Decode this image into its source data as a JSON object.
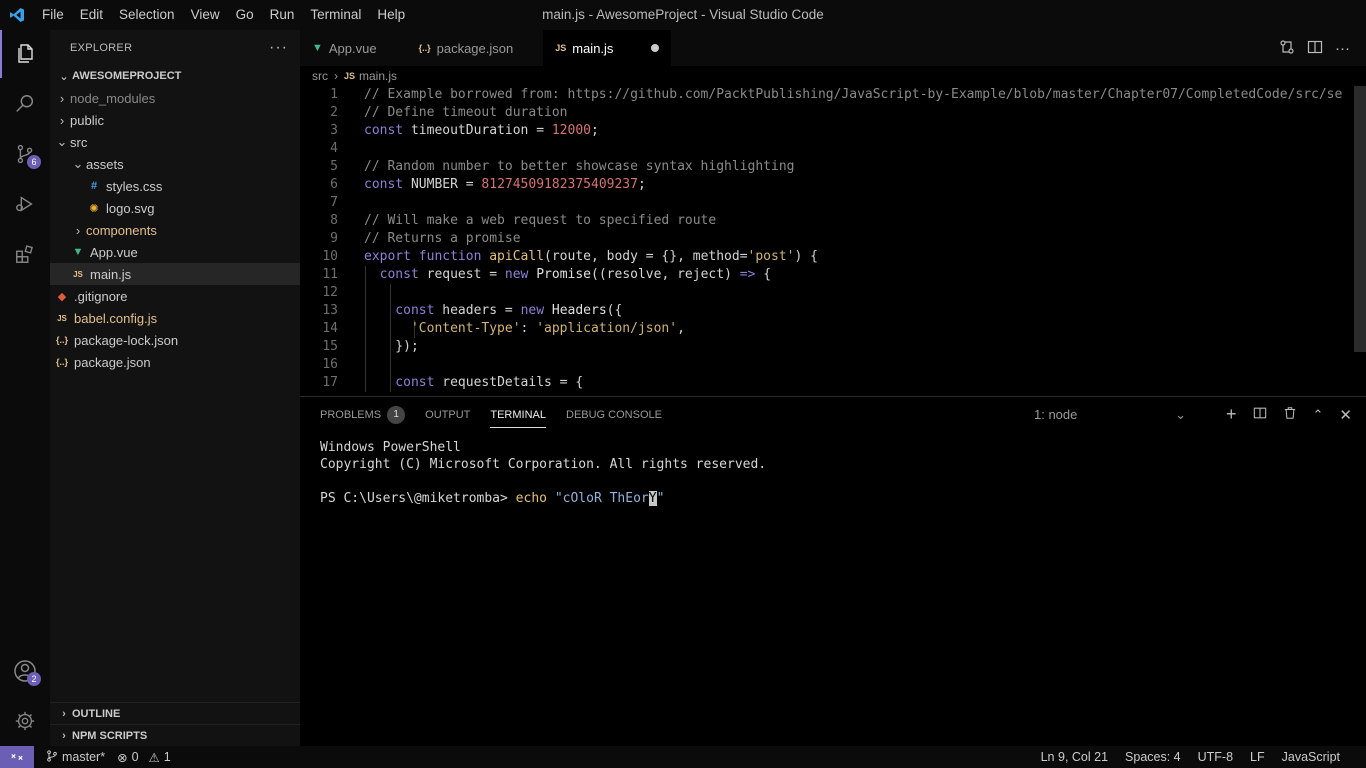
{
  "window": {
    "title": "main.js - AwesomeProject - Visual Studio Code"
  },
  "menu": [
    "File",
    "Edit",
    "Selection",
    "View",
    "Go",
    "Run",
    "Terminal",
    "Help"
  ],
  "activity": {
    "scm_badge": "6",
    "accounts_badge": "2"
  },
  "sidebar": {
    "header": "EXPLORER",
    "project": "AWESOMEPROJECT",
    "tree": [
      {
        "label": "node_modules",
        "indent": 1,
        "type": "folder",
        "open": false,
        "dim": true
      },
      {
        "label": "public",
        "indent": 1,
        "type": "folder",
        "open": false
      },
      {
        "label": "src",
        "indent": 1,
        "type": "folder",
        "open": true
      },
      {
        "label": "assets",
        "indent": 2,
        "type": "folder",
        "open": true
      },
      {
        "label": "styles.css",
        "indent": 3,
        "type": "css"
      },
      {
        "label": "logo.svg",
        "indent": 3,
        "type": "svg"
      },
      {
        "label": "components",
        "indent": 2,
        "type": "folder",
        "open": false,
        "color": "#e2c08d"
      },
      {
        "label": "App.vue",
        "indent": 2,
        "type": "vue"
      },
      {
        "label": "main.js",
        "indent": 2,
        "type": "js",
        "selected": true
      },
      {
        "label": ".gitignore",
        "indent": 1,
        "type": "git"
      },
      {
        "label": "babel.config.js",
        "indent": 1,
        "type": "js",
        "color": "#e2c08d"
      },
      {
        "label": "package-lock.json",
        "indent": 1,
        "type": "json"
      },
      {
        "label": "package.json",
        "indent": 1,
        "type": "json"
      }
    ],
    "outline": "OUTLINE",
    "npm": "NPM SCRIPTS"
  },
  "tabs": [
    {
      "label": "App.vue",
      "type": "vue"
    },
    {
      "label": "package.json",
      "type": "json"
    },
    {
      "label": "main.js",
      "type": "js",
      "active": true,
      "dirty": true
    }
  ],
  "breadcrumb": [
    "src",
    "main.js"
  ],
  "code": [
    {
      "n": "1",
      "depth": 0,
      "t": [
        [
          "c-com",
          "// Example borrowed from: https://github.com/PacktPublishing/JavaScript-by-Example/blob/master/Chapter07/CompletedCode/src/se"
        ]
      ]
    },
    {
      "n": "2",
      "depth": 0,
      "t": [
        [
          "c-com",
          "// Define timeout duration"
        ]
      ]
    },
    {
      "n": "3",
      "depth": 0,
      "t": [
        [
          "c-kw",
          "const "
        ],
        [
          "c-id",
          "timeoutDuration = "
        ],
        [
          "c-num",
          "12000"
        ],
        [
          "c-id",
          ";"
        ]
      ]
    },
    {
      "n": "4",
      "depth": 0,
      "t": []
    },
    {
      "n": "5",
      "depth": 0,
      "t": [
        [
          "c-com",
          "// Random number to better showcase syntax highlighting"
        ]
      ]
    },
    {
      "n": "6",
      "depth": 0,
      "t": [
        [
          "c-kw",
          "const "
        ],
        [
          "c-id",
          "NUMBER = "
        ],
        [
          "c-num",
          "812745091823754092​37"
        ],
        [
          "c-id",
          ";"
        ]
      ]
    },
    {
      "n": "7",
      "depth": 0,
      "t": []
    },
    {
      "n": "8",
      "depth": 0,
      "t": [
        [
          "c-com",
          "// Will make a web request to specified route"
        ]
      ]
    },
    {
      "n": "9",
      "depth": 0,
      "t": [
        [
          "c-com",
          "// Returns a promise"
        ]
      ]
    },
    {
      "n": "10",
      "depth": 0,
      "t": [
        [
          "c-kw",
          "export function "
        ],
        [
          "c-fn",
          "apiCall"
        ],
        [
          "c-id",
          "(route, body = {}, method="
        ],
        [
          "c-str",
          "'post'"
        ],
        [
          "c-id",
          ") {"
        ]
      ]
    },
    {
      "n": "11",
      "depth": 1,
      "t": [
        [
          "c-kw",
          "  const "
        ],
        [
          "c-id",
          "request = "
        ],
        [
          "c-kw",
          "new "
        ],
        [
          "c-cls",
          "Promise"
        ],
        [
          "c-id",
          "((resolve, reject) "
        ],
        [
          "c-kw",
          "=> "
        ],
        [
          "c-id",
          "{"
        ]
      ]
    },
    {
      "n": "12",
      "depth": 2,
      "t": []
    },
    {
      "n": "13",
      "depth": 2,
      "t": [
        [
          "c-kw",
          "    const "
        ],
        [
          "c-id",
          "headers = "
        ],
        [
          "c-kw",
          "new "
        ],
        [
          "c-cls",
          "Headers"
        ],
        [
          "c-id",
          "({"
        ]
      ]
    },
    {
      "n": "14",
      "depth": 3,
      "t": [
        [
          "c-str",
          "      'Content-Type'"
        ],
        [
          "c-id",
          ": "
        ],
        [
          "c-str",
          "'application/json'"
        ],
        [
          "c-id",
          ","
        ]
      ]
    },
    {
      "n": "15",
      "depth": 2,
      "t": [
        [
          "c-id",
          "    });"
        ]
      ]
    },
    {
      "n": "16",
      "depth": 2,
      "t": []
    },
    {
      "n": "17",
      "depth": 2,
      "t": [
        [
          "c-kw",
          "    const "
        ],
        [
          "c-id",
          "requestDetails = {"
        ]
      ]
    }
  ],
  "panel": {
    "tabs": [
      {
        "label": "PROBLEMS",
        "badge": "1"
      },
      {
        "label": "OUTPUT"
      },
      {
        "label": "TERMINAL",
        "active": true
      },
      {
        "label": "DEBUG CONSOLE"
      }
    ],
    "terminal_select": "1: node",
    "terminal_lines": [
      "Windows PowerShell",
      "Copyright (C) Microsoft Corporation. All rights reserved.",
      ""
    ],
    "prompt": "PS C:\\Users\\@miketromba> ",
    "command": "echo ",
    "arg": "\"cOloR ThEor",
    "cursor_char": "Y",
    "arg_end": "\""
  },
  "status": {
    "branch": "master*",
    "errors": "0",
    "warnings": "1",
    "position": "Ln 9, Col 21",
    "spaces": "Spaces: 4",
    "encoding": "UTF-8",
    "eol": "LF",
    "language": "JavaScript"
  },
  "colors": {
    "accent": "#6b5fb5",
    "keyword": "#8f7fd8",
    "string": "#d2b36f",
    "number": "#d97272",
    "comment": "#8a8a8a"
  }
}
